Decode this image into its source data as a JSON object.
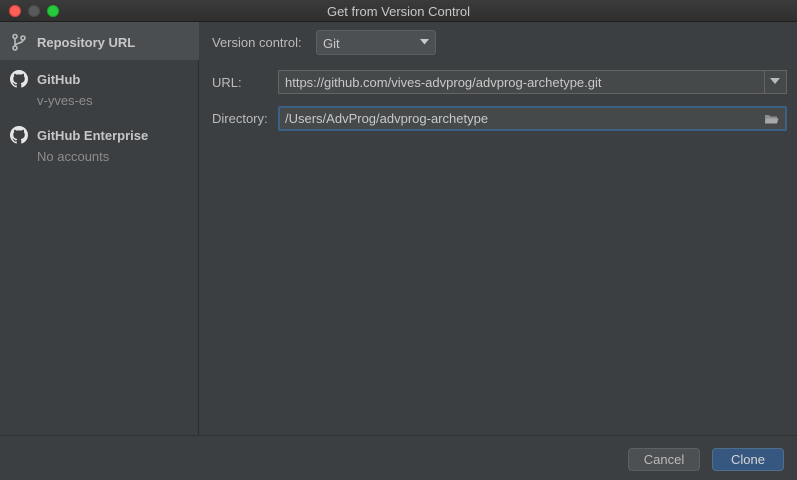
{
  "window": {
    "title": "Get from Version Control"
  },
  "sidebar": {
    "items": [
      {
        "title": "Repository URL",
        "subtitle": "",
        "icon": "git-branch-icon",
        "selected": true
      },
      {
        "title": "GitHub",
        "subtitle": "v-yves-es",
        "icon": "github-icon",
        "selected": false
      },
      {
        "title": "GitHub Enterprise",
        "subtitle": "No accounts",
        "icon": "github-icon",
        "selected": false
      }
    ]
  },
  "form": {
    "version_control_label": "Version control:",
    "version_control_value": "Git",
    "url_label": "URL:",
    "url_value": "https://github.com/vives-advprog/advprog-archetype.git",
    "directory_label": "Directory:",
    "directory_value": "/Users/AdvProg/advprog-archetype"
  },
  "footer": {
    "cancel_label": "Cancel",
    "clone_label": "Clone"
  },
  "colors": {
    "background": "#3c3f41",
    "selection": "#4b4e51",
    "focus_border": "#3d6185",
    "primary_button": "#365880"
  }
}
